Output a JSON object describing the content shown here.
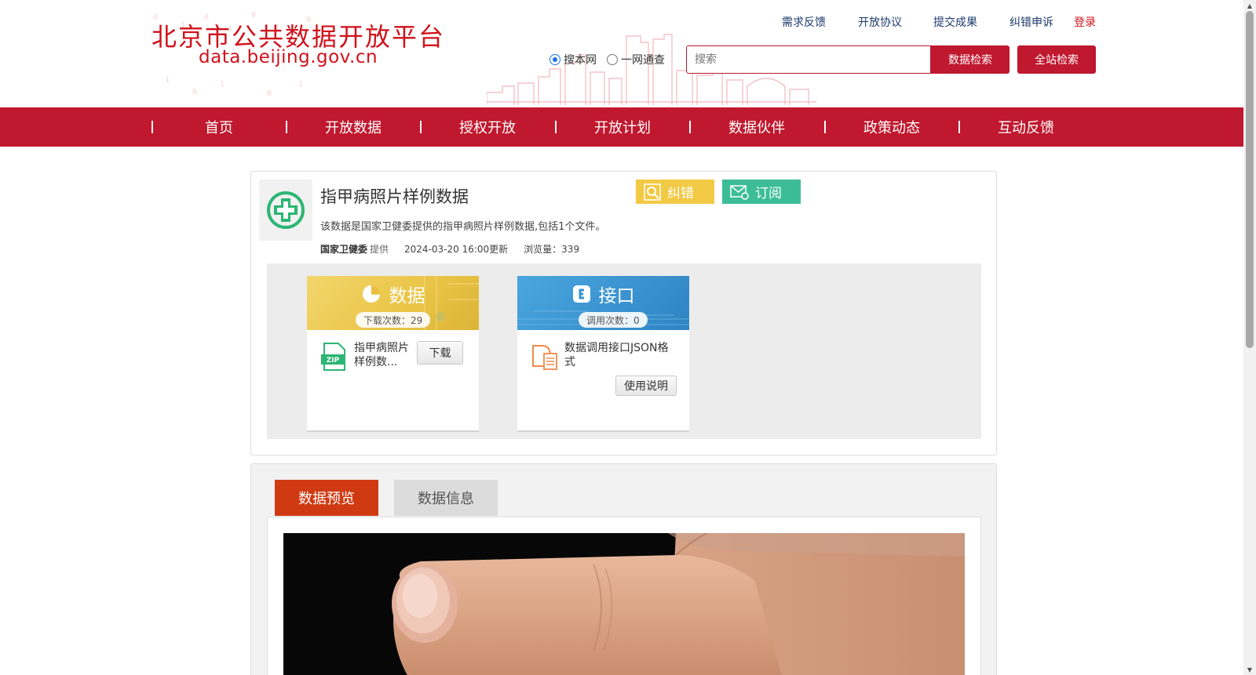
{
  "header": {
    "logo_title": "北京市公共数据开放平台",
    "logo_url": "data.beijing.gov.cn",
    "links": [
      "需求反馈",
      "开放协议",
      "提交成果",
      "纠错申诉"
    ],
    "login": "登录",
    "search_options": [
      {
        "label": "搜本网",
        "checked": true
      },
      {
        "label": "一网通查",
        "checked": false
      }
    ],
    "search_placeholder": "搜索",
    "data_search_label": "数据检索",
    "all_search_label": "全站检索",
    "brand_color": "#c0182e"
  },
  "nav": [
    "首页",
    "开放数据",
    "授权开放",
    "开放计划",
    "数据伙伴",
    "政策动态",
    "互动反馈"
  ],
  "dataset": {
    "title": "指甲病照片样例数据",
    "description": "该数据是国家卫健委提供的指甲病照片样例数据,包括1个文件。",
    "org": "国家卫健委",
    "provided": "提供",
    "updated": "2024-03-20 16:00更新",
    "views": "浏览量：339",
    "correct_label": "纠错",
    "subscribe_label": "订阅"
  },
  "cards": {
    "data": {
      "title": "数据",
      "count": "下载次数：29",
      "file_name": "指甲病照片样例数...",
      "file_icon": "zip-file-icon",
      "button": "下载"
    },
    "api": {
      "title": "接口",
      "count": "调用次数：0",
      "file_name": "数据调用接口JSON格式",
      "file_icon": "api-doc-icon",
      "button": "使用说明"
    }
  },
  "tabs": [
    "数据预览",
    "数据信息"
  ]
}
